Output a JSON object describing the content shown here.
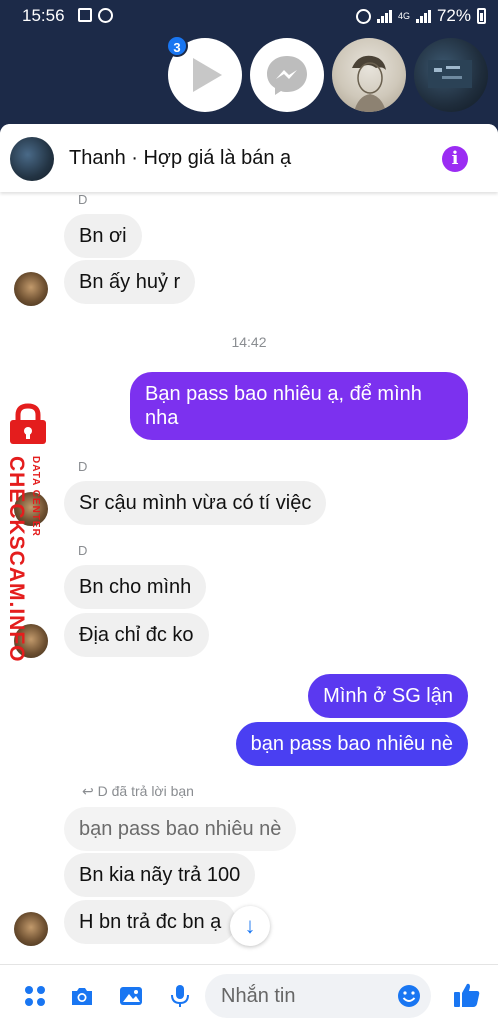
{
  "status_bar": {
    "time": "15:56",
    "network": "4G",
    "battery": "72%"
  },
  "chat_heads": {
    "badge_count": "3",
    "items": [
      "play-icon",
      "messenger-icon",
      "contact-photo",
      "contact-photo"
    ]
  },
  "header": {
    "title": "Thanh · Hợp giá là bán ạ"
  },
  "messages": [
    {
      "type": "sender",
      "text": "D"
    },
    {
      "type": "in",
      "text": "Bn ơi"
    },
    {
      "type": "in",
      "text": "Bn ấy huỷ r"
    },
    {
      "type": "time",
      "text": "14:42"
    },
    {
      "type": "out",
      "text": "Bạn pass bao nhiêu ạ, để mình nha"
    },
    {
      "type": "sender",
      "text": "D"
    },
    {
      "type": "in",
      "text": "Sr cậu mình vừa có tí việc"
    },
    {
      "type": "sender",
      "text": "D"
    },
    {
      "type": "in",
      "text": "Bn cho mình"
    },
    {
      "type": "in",
      "text": "Địa chỉ đc ko"
    },
    {
      "type": "out",
      "text": "Mình ở SG lận"
    },
    {
      "type": "out",
      "text": "bạn pass bao nhiêu nè"
    },
    {
      "type": "reply_note",
      "text": "D đã trả lời bạn"
    },
    {
      "type": "quoted",
      "text": "bạn pass bao nhiêu nè"
    },
    {
      "type": "in",
      "text": "Bn kia nãy trả 100"
    },
    {
      "type": "in",
      "text": "H bn trả đc bn ạ"
    }
  ],
  "watermark": {
    "main": "CHECKSCAM.INFO",
    "sub": "DATA CENTER"
  },
  "composer": {
    "placeholder": "Nhắn tin",
    "icons": [
      "apps-icon",
      "camera-icon",
      "image-icon",
      "microphone-icon",
      "emoji-icon",
      "like-icon"
    ]
  },
  "colors": {
    "header_bg": "#1c2a48",
    "outgoing_purple": "#7c31ef",
    "outgoing_blue": "#4a3ff2",
    "incoming": "#f0f0f0",
    "accent": "#1976f2",
    "info": "#9b2cf3",
    "watermark": "#e41d1d"
  }
}
